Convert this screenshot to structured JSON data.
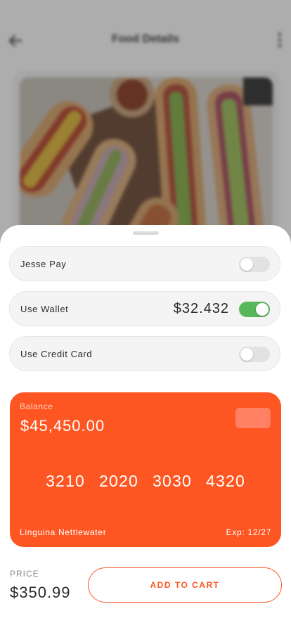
{
  "background": {
    "title": "Food Details",
    "back_icon": "arrow-left-icon",
    "more_icon": "more-vertical-icon"
  },
  "payment_options": [
    {
      "label": "Jesse Pay",
      "amount": "",
      "enabled": false
    },
    {
      "label": "Use Wallet",
      "amount": "$32.432",
      "enabled": true
    },
    {
      "label": "Use Credit Card",
      "amount": "",
      "enabled": false
    }
  ],
  "card": {
    "balance_label": "Balance",
    "balance": "$45,450.00",
    "number_groups": [
      "3210",
      "2020",
      "3030",
      "4320"
    ],
    "holder": "Linguina Nettlewater",
    "expiry": "Exp: 12/27"
  },
  "footer": {
    "price_label": "PRICE",
    "price": "$350.99",
    "add_to_cart_label": "ADD TO CART"
  },
  "colors": {
    "accent": "#fe5622",
    "toggle_on": "#58b75a",
    "toggle_off": "#e2e2e2"
  }
}
